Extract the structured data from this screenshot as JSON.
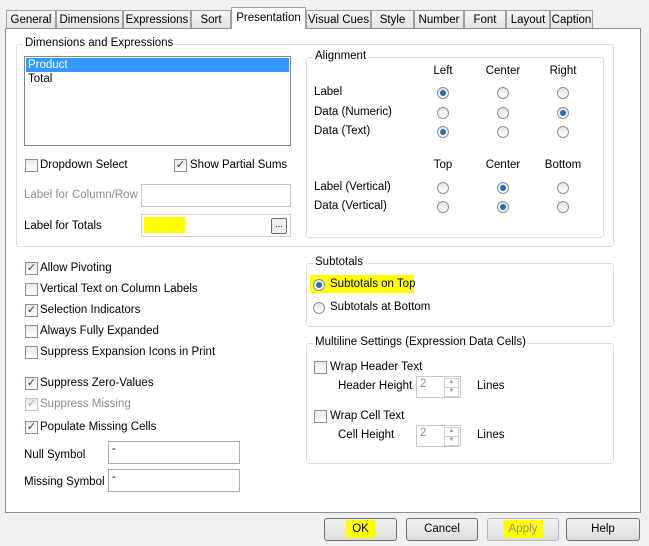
{
  "tabs": [
    "General",
    "Dimensions",
    "Expressions",
    "Sort",
    "Presentation",
    "Visual Cues",
    "Style",
    "Number",
    "Font",
    "Layout",
    "Caption"
  ],
  "active_tab": "Presentation",
  "dims": {
    "title": "Dimensions and Expressions",
    "items": [
      "Product",
      "Total"
    ],
    "selected": "Product"
  },
  "dropdown_select": {
    "label": "Dropdown Select",
    "checked": false
  },
  "show_partial_sums": {
    "label": "Show Partial Sums",
    "checked": true
  },
  "label_col_row": {
    "label": "Label for Column/Row",
    "value": ""
  },
  "label_totals": {
    "label": "Label for Totals",
    "value": "",
    "browse": "..."
  },
  "alignment": {
    "title": "Alignment",
    "h_headers": [
      "Left",
      "Center",
      "Right"
    ],
    "v_headers": [
      "Top",
      "Center",
      "Bottom"
    ],
    "rows": [
      {
        "label": "Label",
        "selected": 0
      },
      {
        "label": "Data (Numeric)",
        "selected": 2
      },
      {
        "label": "Data (Text)",
        "selected": 0
      }
    ],
    "vrows": [
      {
        "label": "Label (Vertical)",
        "selected": 1
      },
      {
        "label": "Data (Vertical)",
        "selected": 1
      }
    ]
  },
  "options": [
    {
      "label": "Allow Pivoting",
      "checked": true
    },
    {
      "label": "Vertical Text on Column Labels",
      "checked": false
    },
    {
      "label": "Selection Indicators",
      "checked": true
    },
    {
      "label": "Always Fully Expanded",
      "checked": false
    },
    {
      "label": "Suppress Expansion Icons in Print",
      "checked": false
    },
    {
      "label": "Suppress Zero-Values",
      "checked": true
    },
    {
      "label": "Suppress Missing",
      "checked": true,
      "disabled": true
    },
    {
      "label": "Populate Missing Cells",
      "checked": true
    }
  ],
  "null_symbol": {
    "label": "Null Symbol",
    "value": "-"
  },
  "missing_symbol": {
    "label": "Missing Symbol",
    "value": "-"
  },
  "subtotals": {
    "title": "Subtotals",
    "on_top": "Subtotals on Top",
    "at_bottom": "Subtotals at Bottom",
    "selected": "top"
  },
  "multiline": {
    "title": "Multiline Settings (Expression Data Cells)",
    "wrap_header": "Wrap Header Text",
    "header_height": "Header Height",
    "header_value": "2",
    "wrap_cell": "Wrap Cell Text",
    "cell_height": "Cell Height",
    "cell_value": "2",
    "lines": "Lines"
  },
  "buttons": {
    "ok": "OK",
    "cancel": "Cancel",
    "apply": "Apply",
    "help": "Help"
  }
}
